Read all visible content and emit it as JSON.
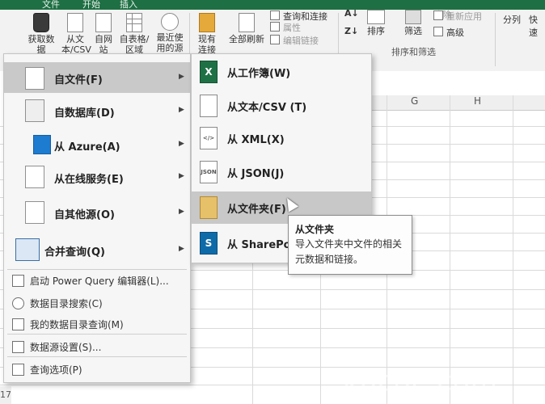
{
  "ribbon": {
    "tabs": [
      "文件",
      "开始",
      "插入"
    ],
    "buttons": {
      "get_data": "获取数据",
      "from_text_csv": "从文本/CSV",
      "from_web": "自网站",
      "from_table": "自表格/区域",
      "recent_sources": "最近使用的源",
      "existing_connections": "现有连接",
      "refresh_all": "全部刷新",
      "queries_connections": "查询和连接",
      "properties": "属性",
      "edit_links": "编辑链接",
      "sort": "排序",
      "filter": "筛选",
      "clear": "清除",
      "reapply": "重新应用",
      "advanced": "高级",
      "text_to_columns": "分列",
      "flash_fill": "快速"
    },
    "group_sort_filter": "排序和筛选"
  },
  "sheet": {
    "columns": [
      "G",
      "H"
    ],
    "row_number": "17"
  },
  "menu": {
    "items": [
      {
        "label": "自文件(F)",
        "icon": "file-icon",
        "has_submenu": true
      },
      {
        "label": "自数据库(D)",
        "icon": "database-icon",
        "has_submenu": true
      },
      {
        "label": "从 Azure(A)",
        "icon": "azure-icon",
        "has_submenu": true
      },
      {
        "label": "从在线服务(E)",
        "icon": "online-service-icon",
        "has_submenu": true
      },
      {
        "label": "自其他源(O)",
        "icon": "other-source-icon",
        "has_submenu": true
      },
      {
        "label": "合并查询(Q)",
        "icon": "combine-queries-icon",
        "has_submenu": true
      }
    ],
    "commands": [
      {
        "label": "启动 Power Query 编辑器(L)...",
        "icon": "power-query-icon"
      },
      {
        "label": "数据目录搜索(C)",
        "icon": "catalog-search-icon"
      },
      {
        "label": "我的数据目录查询(M)",
        "icon": "my-catalog-icon"
      },
      {
        "label": "数据源设置(S)...",
        "icon": "data-source-settings-icon"
      },
      {
        "label": "查询选项(P)",
        "icon": "query-options-icon"
      }
    ]
  },
  "submenu": {
    "items": [
      {
        "label": "从工作簿(W)",
        "icon": "excel-workbook-icon",
        "icon_text": "X"
      },
      {
        "label": "从文本/CSV (T)",
        "icon": "text-file-icon",
        "icon_text": ""
      },
      {
        "label": "从 XML(X)",
        "icon": "xml-file-icon",
        "icon_text": "</>"
      },
      {
        "label": "从 JSON(J)",
        "icon": "json-file-icon",
        "icon_text": "JSON"
      },
      {
        "label": "从文件夹(F)",
        "icon": "folder-icon",
        "icon_text": ""
      },
      {
        "label": "从 SharePoi",
        "icon": "sharepoint-icon",
        "icon_text": "S"
      }
    ]
  },
  "tooltip": {
    "title": "从文件夹",
    "description": "导入文件夹中文件的相关元数据和链接。"
  },
  "watermark": "khcoc.com"
}
